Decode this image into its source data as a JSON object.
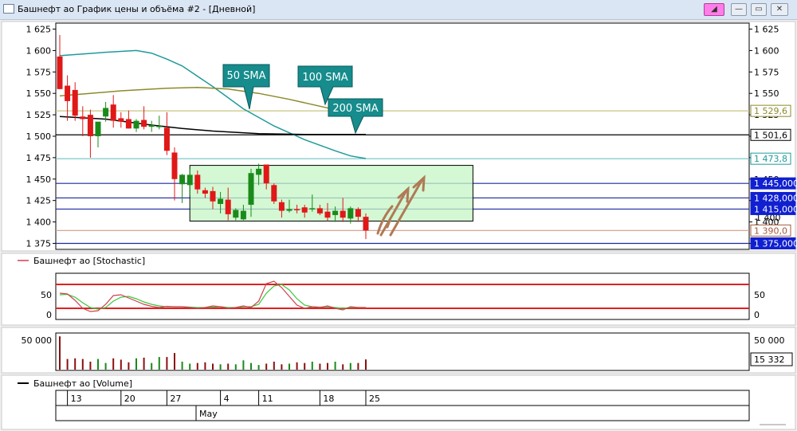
{
  "window": {
    "title": "Башнефт ао График цены и объёма #2 - [Дневной]",
    "buttons": [
      "◢",
      "—",
      "▭",
      "✕"
    ]
  },
  "price_panel": {
    "y_ticks": [
      "1 625",
      "1 600",
      "1 575",
      "1 550",
      "1 525",
      "1 500",
      "1 475",
      "1 450",
      "1 425",
      "1 400",
      "1 375"
    ],
    "tags": [
      {
        "label": "1 529,6",
        "value": 1529.6,
        "color": "#8c8a2a",
        "style": "outline"
      },
      {
        "label": "1 501,6",
        "value": 1501.6,
        "color": "#000000",
        "style": "outline"
      },
      {
        "label": "1 473,8",
        "value": 1473.8,
        "color": "#1f9a9a",
        "style": "outline"
      },
      {
        "label": "1 445,000",
        "value": 1445,
        "color": "#1020d0",
        "style": "filled"
      },
      {
        "label": "1 428,000",
        "value": 1428,
        "color": "#1020d0",
        "style": "filled"
      },
      {
        "label": "1 415,000",
        "value": 1415,
        "color": "#1020d0",
        "style": "filled"
      },
      {
        "label": "1 390,0",
        "value": 1390,
        "color": "#a05a3c",
        "style": "outline"
      },
      {
        "label": "1 375,000",
        "value": 1375,
        "color": "#1020d0",
        "style": "filled"
      }
    ],
    "partial_tick": "1 400",
    "sma_callouts": [
      "50 SMA",
      "100 SMA",
      "200 SMA"
    ]
  },
  "stochastic_panel": {
    "legend": "Башнефт ао [Stochastic]",
    "y_ticks": [
      "50",
      "0"
    ],
    "right_ticks": [
      "50",
      "0"
    ]
  },
  "volume_panel": {
    "left_tick": "50 000",
    "right_tick": "50 000",
    "last_value": "15 332"
  },
  "volume_legend": "Башнефт ао [Volume]",
  "date_axis": {
    "ticks": [
      "13",
      "20",
      "27",
      "4",
      "11",
      "18",
      "25"
    ],
    "month": "May"
  },
  "chart_data": {
    "type": "candlestick",
    "ylim": [
      1368,
      1632
    ],
    "candles": [
      {
        "o": 1593,
        "h": 1618,
        "l": 1555,
        "c": 1555
      },
      {
        "o": 1559,
        "h": 1571,
        "l": 1518,
        "c": 1541
      },
      {
        "o": 1554,
        "h": 1563,
        "l": 1518,
        "c": 1524
      },
      {
        "o": 1523,
        "h": 1535,
        "l": 1500,
        "c": 1520
      },
      {
        "o": 1525,
        "h": 1531,
        "l": 1475,
        "c": 1500
      },
      {
        "o": 1500,
        "h": 1516,
        "l": 1487,
        "c": 1517
      },
      {
        "o": 1523,
        "h": 1540,
        "l": 1517,
        "c": 1533
      },
      {
        "o": 1537,
        "h": 1548,
        "l": 1510,
        "c": 1518
      },
      {
        "o": 1521,
        "h": 1528,
        "l": 1510,
        "c": 1517
      },
      {
        "o": 1520,
        "h": 1530,
        "l": 1509,
        "c": 1509
      },
      {
        "o": 1509,
        "h": 1520,
        "l": 1505,
        "c": 1518
      },
      {
        "o": 1519,
        "h": 1535,
        "l": 1508,
        "c": 1511
      },
      {
        "o": 1511,
        "h": 1518,
        "l": 1505,
        "c": 1513
      },
      {
        "o": 1511,
        "h": 1524,
        "l": 1508,
        "c": 1512
      },
      {
        "o": 1510,
        "h": 1528,
        "l": 1478,
        "c": 1483
      },
      {
        "o": 1481,
        "h": 1487,
        "l": 1425,
        "c": 1450
      },
      {
        "o": 1444,
        "h": 1456,
        "l": 1422,
        "c": 1455
      },
      {
        "o": 1443,
        "h": 1462,
        "l": 1431,
        "c": 1455
      },
      {
        "o": 1455,
        "h": 1460,
        "l": 1433,
        "c": 1438
      },
      {
        "o": 1437,
        "h": 1440,
        "l": 1428,
        "c": 1433
      },
      {
        "o": 1436,
        "h": 1441,
        "l": 1415,
        "c": 1424
      },
      {
        "o": 1421,
        "h": 1435,
        "l": 1410,
        "c": 1427
      },
      {
        "o": 1426,
        "h": 1440,
        "l": 1402,
        "c": 1409
      },
      {
        "o": 1405,
        "h": 1416,
        "l": 1402,
        "c": 1414
      },
      {
        "o": 1403,
        "h": 1420,
        "l": 1402,
        "c": 1413
      },
      {
        "o": 1420,
        "h": 1462,
        "l": 1406,
        "c": 1457
      },
      {
        "o": 1455,
        "h": 1468,
        "l": 1443,
        "c": 1462
      },
      {
        "o": 1467,
        "h": 1467,
        "l": 1438,
        "c": 1445
      },
      {
        "o": 1443,
        "h": 1445,
        "l": 1421,
        "c": 1424
      },
      {
        "o": 1423,
        "h": 1426,
        "l": 1405,
        "c": 1413
      },
      {
        "o": 1413,
        "h": 1426,
        "l": 1411,
        "c": 1415
      },
      {
        "o": 1415,
        "h": 1420,
        "l": 1410,
        "c": 1414
      },
      {
        "o": 1417,
        "h": 1420,
        "l": 1405,
        "c": 1411
      },
      {
        "o": 1416,
        "h": 1432,
        "l": 1412,
        "c": 1416
      },
      {
        "o": 1416,
        "h": 1420,
        "l": 1408,
        "c": 1410
      },
      {
        "o": 1412,
        "h": 1422,
        "l": 1401,
        "c": 1405
      },
      {
        "o": 1408,
        "h": 1418,
        "l": 1400,
        "c": 1413
      },
      {
        "o": 1413,
        "h": 1428,
        "l": 1400,
        "c": 1405
      },
      {
        "o": 1404,
        "h": 1418,
        "l": 1398,
        "c": 1416
      },
      {
        "o": 1415,
        "h": 1417,
        "l": 1400,
        "c": 1406
      },
      {
        "o": 1406,
        "h": 1410,
        "l": 1380,
        "c": 1390
      }
    ],
    "sma": [
      {
        "name": "50 SMA",
        "color": "#1f9a9a",
        "x": [
          0,
          6,
          10,
          12,
          14,
          16,
          20,
          24,
          28,
          32,
          36,
          38,
          40
        ],
        "y": [
          1594,
          1598,
          1600,
          1597,
          1590,
          1582,
          1558,
          1532,
          1512,
          1496,
          1483,
          1477,
          1474
        ]
      },
      {
        "name": "100 SMA",
        "color": "#8c8a2a",
        "x": [
          0,
          8,
          14,
          18,
          22,
          26,
          30,
          34,
          36,
          40
        ],
        "y": [
          1547,
          1553,
          1556,
          1557,
          1555,
          1550,
          1543,
          1535,
          1531,
          1530
        ]
      },
      {
        "name": "200 SMA",
        "color": "#000000",
        "x": [
          0,
          6,
          12,
          16,
          20,
          26,
          32,
          38,
          40
        ],
        "y": [
          1523,
          1520,
          1513,
          1509,
          1506,
          1503,
          1502,
          1502,
          1502
        ]
      }
    ],
    "consolidation_box": {
      "x0": 17,
      "x1": 54,
      "y_low": 1401,
      "y_high": 1466
    },
    "levels": [
      {
        "value": 1529.6,
        "color": "#c8c480"
      },
      {
        "value": 1501.6,
        "color": "#000000"
      },
      {
        "value": 1473.8,
        "color": "#6fc4c4"
      },
      {
        "value": 1445,
        "color": "#1a2aa0"
      },
      {
        "value": 1428,
        "color": "#1a2aa0"
      },
      {
        "value": 1415,
        "color": "#1a2aa0"
      },
      {
        "value": 1390,
        "color": "#d29a85"
      },
      {
        "value": 1375,
        "color": "#1a2aa0"
      }
    ],
    "stochastic": {
      "ylim": [
        -8,
        108
      ],
      "levels": [
        80,
        20
      ],
      "k": [
        58,
        56,
        40,
        20,
        12,
        14,
        30,
        52,
        54,
        46,
        38,
        30,
        25,
        22,
        25,
        24,
        24,
        22,
        20,
        22,
        26,
        24,
        20,
        22,
        26,
        22,
        38,
        82,
        88,
        72,
        50,
        28,
        20,
        24,
        22,
        26,
        20,
        16,
        24,
        22,
        22
      ],
      "d": [
        54,
        55,
        48,
        34,
        22,
        18,
        22,
        38,
        48,
        50,
        44,
        36,
        30,
        26,
        24,
        24,
        24,
        23,
        22,
        22,
        23,
        24,
        22,
        22,
        24,
        24,
        30,
        58,
        76,
        80,
        66,
        44,
        28,
        24,
        23,
        24,
        22,
        20,
        22,
        22,
        22
      ]
    },
    "volume": {
      "ylim": [
        0,
        55000
      ],
      "values": [
        50000,
        16000,
        17000,
        16000,
        12000,
        16000,
        10000,
        17000,
        15000,
        11000,
        17000,
        18000,
        10000,
        19000,
        19000,
        25000,
        12000,
        9000,
        10000,
        11000,
        9000,
        8000,
        9000,
        8000,
        14000,
        10000,
        7000,
        9000,
        12000,
        8000,
        9000,
        11000,
        10000,
        12000,
        9000,
        10000,
        12000,
        8000,
        10000,
        10000,
        15332
      ]
    }
  }
}
